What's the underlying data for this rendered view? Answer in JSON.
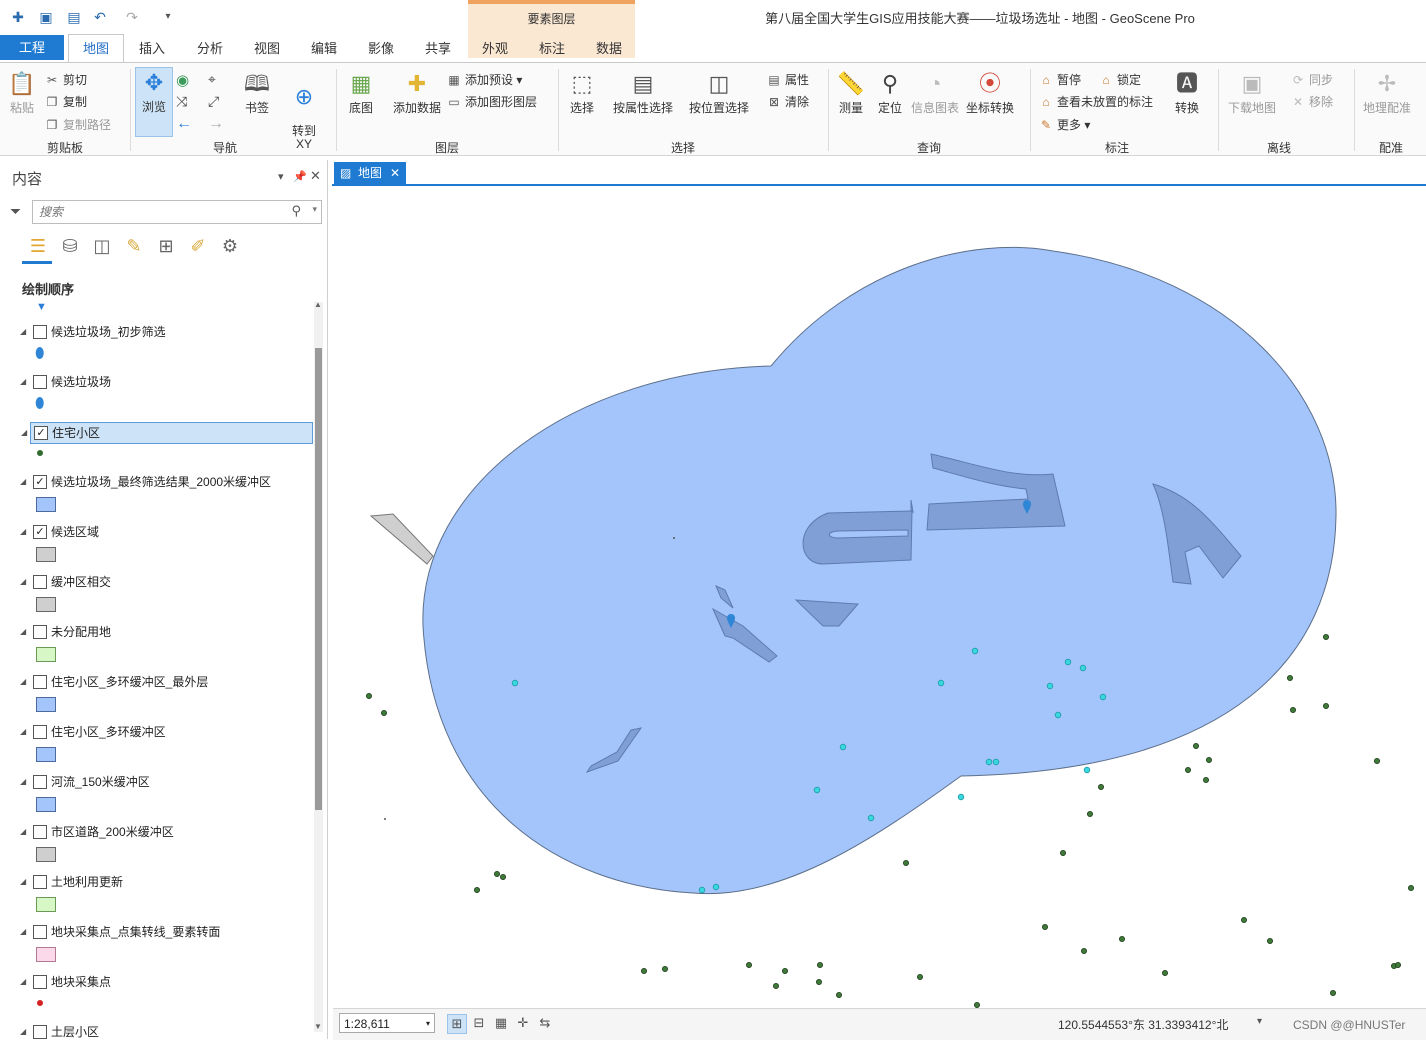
{
  "title_bar": {
    "title": "第八届全国大学生GIS应用技能大赛——垃圾场选址 - 地图 - GeoScene Pro"
  },
  "contextual_tab": {
    "label": "要素图层"
  },
  "tabs": {
    "file": "工程",
    "map": "地图",
    "insert": "插入",
    "analysis": "分析",
    "view": "视图",
    "edit": "编辑",
    "imagery": "影像",
    "share": "共享",
    "appearance": "外观",
    "labeling": "标注",
    "data": "数据"
  },
  "ribbon": {
    "clipboard": {
      "paste": "粘贴",
      "cut": "剪切",
      "copy": "复制",
      "copy_path": "复制路径",
      "label": "剪贴板"
    },
    "navigate": {
      "explore": "浏览",
      "bookmarks": "书签",
      "goto_xy": "转到\nXY",
      "label": "导航"
    },
    "layer": {
      "basemap": "底图",
      "add_data": "添加数据",
      "add_preset": "添加预设",
      "add_graphics_layer": "添加图形图层",
      "label": "图层"
    },
    "selection": {
      "select": "选择",
      "select_by_attr": "按属性选择",
      "select_by_loc": "按位置选择",
      "attributes": "属性",
      "clear": "清除",
      "label": "选择"
    },
    "inquiry": {
      "measure": "测量",
      "locate": "定位",
      "infographics": "信息图表",
      "convert_coords": "坐标转换",
      "label": "查询"
    },
    "labeling": {
      "pause": "暂停",
      "lock": "锁定",
      "view_unplaced": "查看未放置的标注",
      "more": "更多",
      "convert": "转换",
      "label": "标注"
    },
    "offline": {
      "download_map": "下载地图",
      "sync": "同步",
      "remove": "移除",
      "label": "离线"
    },
    "georef": {
      "georeference": "地理配准",
      "label": "配准"
    }
  },
  "contents": {
    "title": "内容",
    "search_placeholder": "搜索",
    "drawing_order": "绘制顺序",
    "layers": [
      {
        "name": "候选垃圾场_初步筛选",
        "checked": false,
        "symbol": "marker-blue"
      },
      {
        "name": "候选垃圾场",
        "checked": false,
        "symbol": "marker-blue"
      },
      {
        "name": "住宅小区",
        "checked": true,
        "selected": true,
        "symbol": "dot-green"
      },
      {
        "name": "候选垃圾场_最终筛选结果_2000米缓冲区",
        "checked": true,
        "symbol": "fill-blue"
      },
      {
        "name": "候选区域",
        "checked": true,
        "symbol": "fill-gray"
      },
      {
        "name": "缓冲区相交",
        "checked": false,
        "symbol": "fill-gray"
      },
      {
        "name": "未分配用地",
        "checked": false,
        "symbol": "fill-lightgreen"
      },
      {
        "name": "住宅小区_多环缓冲区_最外层",
        "checked": false,
        "symbol": "fill-blue"
      },
      {
        "name": "住宅小区_多环缓冲区",
        "checked": false,
        "symbol": "fill-blue"
      },
      {
        "name": "河流_150米缓冲区",
        "checked": false,
        "symbol": "fill-blue"
      },
      {
        "name": "市区道路_200米缓冲区",
        "checked": false,
        "symbol": "fill-gray"
      },
      {
        "name": "土地利用更新",
        "checked": false,
        "symbol": "fill-lightgreen"
      },
      {
        "name": "地块采集点_点集转线_要素转面",
        "checked": false,
        "symbol": "fill-pink"
      },
      {
        "name": "地块采集点",
        "checked": false,
        "symbol": "dot-red"
      },
      {
        "name": "土层小区",
        "checked": false,
        "symbol": "none"
      }
    ]
  },
  "map_tab": {
    "label": "地图"
  },
  "status": {
    "scale": "1:28,611",
    "coordinates": "120.5544553°东 31.3393412°北",
    "watermark": "CSDN @@HNUSTer"
  },
  "colors": {
    "accent": "#1f7ad1",
    "buffer_fill": "#a4c5fb",
    "polygon_fill": "#7f9fd6",
    "dot_green": "#2f6b2f",
    "dot_cyan": "#39d7e0"
  }
}
